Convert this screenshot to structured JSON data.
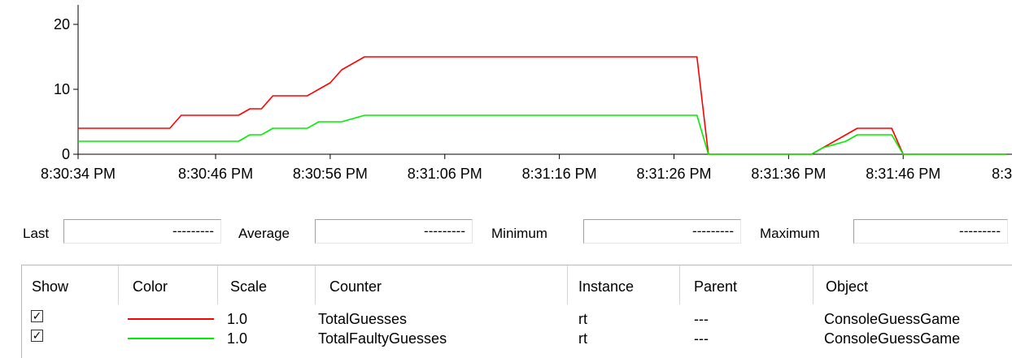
{
  "chart_data": {
    "type": "line",
    "y_ticks": [
      "0",
      "10",
      "20"
    ],
    "ylim": [
      0,
      23
    ],
    "x_tick_labels": [
      "8:30:34 PM",
      "8:30:46 PM",
      "8:30:56 PM",
      "8:31:06 PM",
      "8:31:16 PM",
      "8:31:26 PM",
      "8:31:36 PM",
      "8:31:46 PM",
      "8:31:"
    ],
    "x_tick_seconds": [
      0,
      12,
      22,
      32,
      42,
      52,
      62,
      72,
      82
    ],
    "xlim": [
      0,
      81
    ],
    "grid": false,
    "series": [
      {
        "name": "TotalGuesses",
        "color": "#ff0000",
        "points": [
          [
            0,
            4
          ],
          [
            8,
            4
          ],
          [
            9,
            6
          ],
          [
            14,
            6
          ],
          [
            15,
            7
          ],
          [
            16,
            7
          ],
          [
            17,
            9
          ],
          [
            20,
            9
          ],
          [
            21,
            10
          ],
          [
            22,
            11
          ],
          [
            23,
            13
          ],
          [
            24,
            14
          ],
          [
            25,
            15
          ],
          [
            54,
            15
          ],
          [
            55,
            0
          ],
          [
            64,
            0
          ],
          [
            65,
            1
          ],
          [
            66,
            2
          ],
          [
            67,
            3
          ],
          [
            68,
            4
          ],
          [
            71,
            4
          ],
          [
            72,
            0
          ],
          [
            81,
            0
          ]
        ]
      },
      {
        "name": "TotalFaultyGuesses",
        "color": "#00ee00",
        "points": [
          [
            0,
            2
          ],
          [
            14,
            2
          ],
          [
            15,
            3
          ],
          [
            16,
            3
          ],
          [
            17,
            4
          ],
          [
            20,
            4
          ],
          [
            21,
            5
          ],
          [
            23,
            5
          ],
          [
            25,
            6
          ],
          [
            54,
            6
          ],
          [
            55,
            0
          ],
          [
            64,
            0
          ],
          [
            65,
            1
          ],
          [
            67,
            2
          ],
          [
            68,
            3
          ],
          [
            71,
            3
          ],
          [
            72,
            0
          ],
          [
            81,
            0
          ]
        ]
      }
    ]
  },
  "stats": {
    "last_label": "Last",
    "last_value": "---------",
    "average_label": "Average",
    "average_value": "---------",
    "minimum_label": "Minimum",
    "minimum_value": "---------",
    "maximum_label": "Maximum",
    "maximum_value": "---------"
  },
  "table": {
    "headers": {
      "show": "Show",
      "color": "Color",
      "scale": "Scale",
      "counter": "Counter",
      "instance": "Instance",
      "parent": "Parent",
      "object": "Object"
    },
    "rows": [
      {
        "checked": "✓",
        "color": "#ff0000",
        "scale": "1.0",
        "counter": "TotalGuesses",
        "instance": "rt",
        "parent": "---",
        "object": "ConsoleGuessGame"
      },
      {
        "checked": "✓",
        "color": "#00ee00",
        "scale": "1.0",
        "counter": "TotalFaultyGuesses",
        "instance": "rt",
        "parent": "---",
        "object": "ConsoleGuessGame"
      }
    ]
  }
}
